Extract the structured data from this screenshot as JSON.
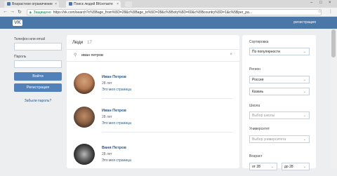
{
  "browser": {
    "tabs": [
      {
        "label": "Возрастное ограничение"
      },
      {
        "label": "Поиск людей ВКонтакте"
      }
    ],
    "secure_label": "Защищено",
    "url": "https://vk.com/search?c%5Bage_from%5D=28&c%5Bage_to%5D=28&c%5Bcity%5D=60&c%5Bcountry%5D=1&c%5Bper_pa..."
  },
  "header": {
    "logo": "VK",
    "register_link": "регистрация"
  },
  "login": {
    "email_label": "Телефон или email",
    "password_label": "Пароль",
    "login_button": "Войти",
    "register_button": "Регистрация",
    "forgot": "Забыли пароль?"
  },
  "results": {
    "title": "Люди",
    "count": "17",
    "query": "иван петров",
    "people": [
      {
        "name": "Иван Петров",
        "age": "28 лет",
        "link": "Это моя страница"
      },
      {
        "name": "Иван Петров",
        "age": "28 лет",
        "link": "Это моя страница"
      },
      {
        "name": "Ваня Петров",
        "age": "28 лет",
        "link": "Это моя страница"
      }
    ]
  },
  "filters": {
    "sort_label": "Сортировка",
    "sort_value": "По популярности",
    "region_label": "Регион",
    "country_value": "Россия",
    "city_value": "Казань",
    "school_label": "Школа",
    "school_placeholder": "Выбор школы",
    "university_label": "Университет",
    "university_placeholder": "Выбор университета",
    "age_label": "Возраст",
    "age_from": "от 28",
    "age_to": "до 28"
  },
  "colors": {
    "brand": "#4a76a8",
    "link": "#2a5885",
    "background": "#edeef0"
  }
}
